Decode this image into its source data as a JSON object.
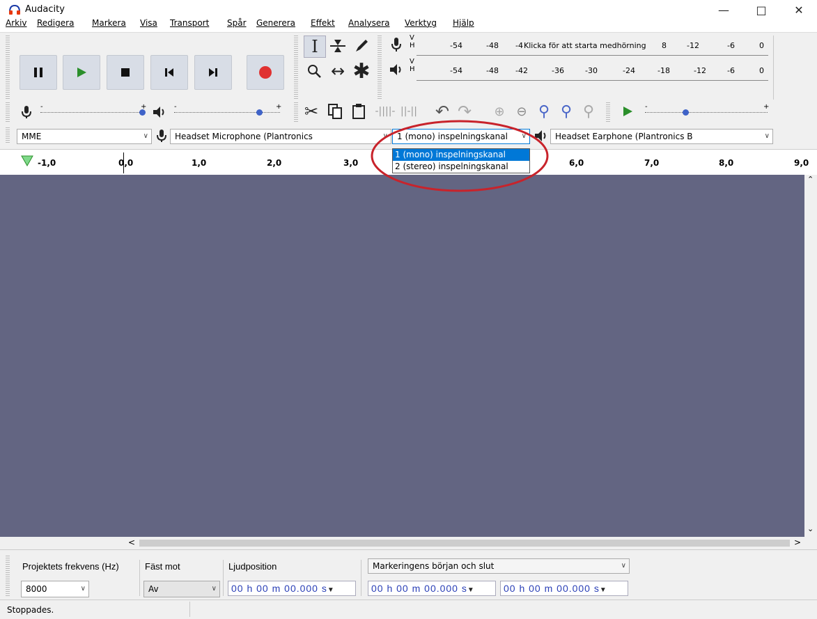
{
  "window": {
    "title": "Audacity"
  },
  "menu": [
    "Arkiv",
    "Redigera",
    "Markera",
    "Visa",
    "Transport",
    "Spår",
    "Generera",
    "Effekt",
    "Analysera",
    "Verktyg",
    "Hjälp"
  ],
  "meters": {
    "record_channels": [
      "V",
      "H"
    ],
    "play_channels": [
      "V",
      "H"
    ],
    "record_scale": [
      "-54",
      "-48",
      "-4",
      "8",
      "-12",
      "-6",
      "0"
    ],
    "record_prompt": "Klicka för att starta medhörning",
    "play_scale": [
      "-54",
      "-48",
      "-42",
      "-36",
      "-30",
      "-24",
      "-18",
      "-12",
      "-6",
      "0"
    ]
  },
  "mixer": {
    "rec_minus": "-",
    "rec_plus": "+",
    "play_minus": "-",
    "play_plus": "+",
    "speed_minus": "-",
    "speed_plus": "+"
  },
  "device": {
    "host": "MME",
    "input": "Headset Microphone (Plantronics",
    "channels": "1 (mono) inspelningskanal",
    "channels_options": [
      "1 (mono) inspelningskanal",
      "2 (stereo) inspelningskanal"
    ],
    "output": "Headset Earphone (Plantronics B"
  },
  "ruler": [
    "-1,0",
    "0,0",
    "1,0",
    "2,0",
    "3,0",
    "6,0",
    "7,0",
    "8,0",
    "9,0"
  ],
  "selection": {
    "rate_label": "Projektets frekvens (Hz)",
    "rate_value": "8000",
    "snap_label": "Fäst mot",
    "snap_value": "Av",
    "audio_pos_label": "Ljudposition",
    "audio_pos_value": "00 h 00 m 00.000 s",
    "sel_mode": "Markeringens början och slut",
    "sel_start": "00 h 00 m 00.000 s",
    "sel_end": "00 h 00 m 00.000 s"
  },
  "status": {
    "text": "Stoppades."
  }
}
